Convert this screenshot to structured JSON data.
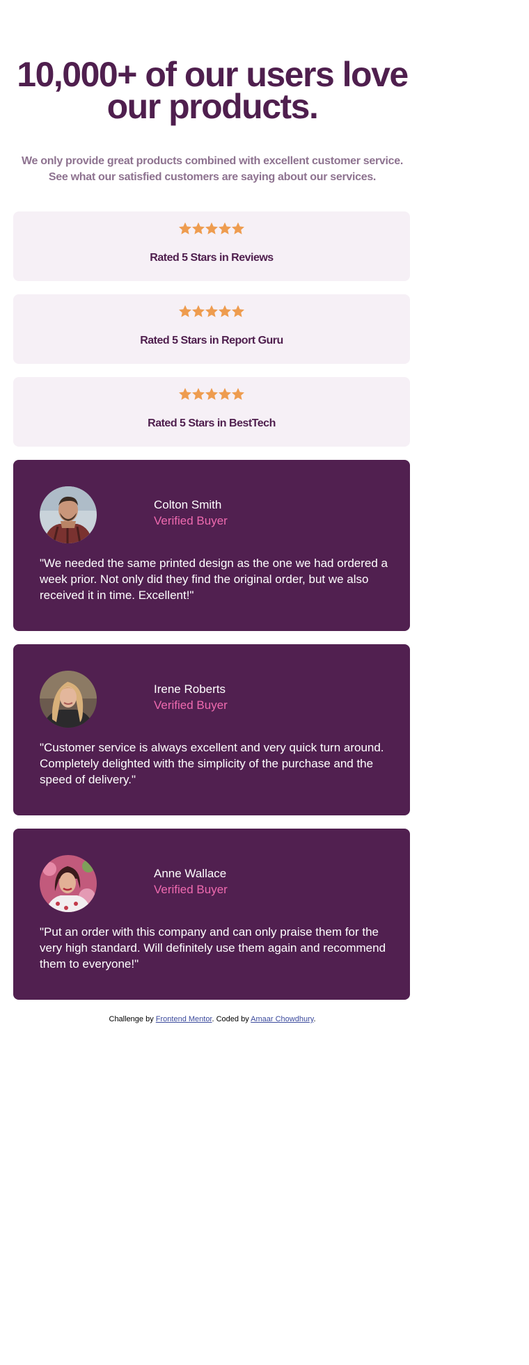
{
  "header": {
    "title": "10,000+ of our users love our products.",
    "description": "We only provide great products combined with excellent customer service. See what our satisfied customers are saying about our services."
  },
  "ratings": [
    {
      "stars": 5,
      "label": "Rated 5 Stars in Reviews"
    },
    {
      "stars": 5,
      "label": "Rated 5 Stars in Report Guru"
    },
    {
      "stars": 5,
      "label": "Rated 5 Stars in BestTech"
    }
  ],
  "testimonials": [
    {
      "name": "Colton Smith",
      "role": "Verified Buyer",
      "quote": "\"We needed the same printed design as the one we had ordered a week prior. Not only did they find the original order, but we also received it in time. Excellent!\""
    },
    {
      "name": "Irene Roberts",
      "role": "Verified Buyer",
      "quote": "\"Customer service is always excellent and very quick turn around. Completely delighted with the simplicity of the purchase and the speed of delivery.\""
    },
    {
      "name": "Anne Wallace",
      "role": "Verified Buyer",
      "quote": "\"Put an order with this company and can only praise them for the very high standard. Will definitely use them again and recommend them to everyone!\""
    }
  ],
  "footer": {
    "prefix": "Challenge by ",
    "link1": "Frontend Mentor",
    "middle": ". Coded by ",
    "link2": "Amaar Chowdhury",
    "suffix": "."
  },
  "colors": {
    "heading": "#4f1f4e",
    "body_muted": "#8e7390",
    "rating_bg": "#f6f0f6",
    "star": "#ee9c4f",
    "card_bg": "#512050",
    "accent": "#ee6aaf"
  }
}
